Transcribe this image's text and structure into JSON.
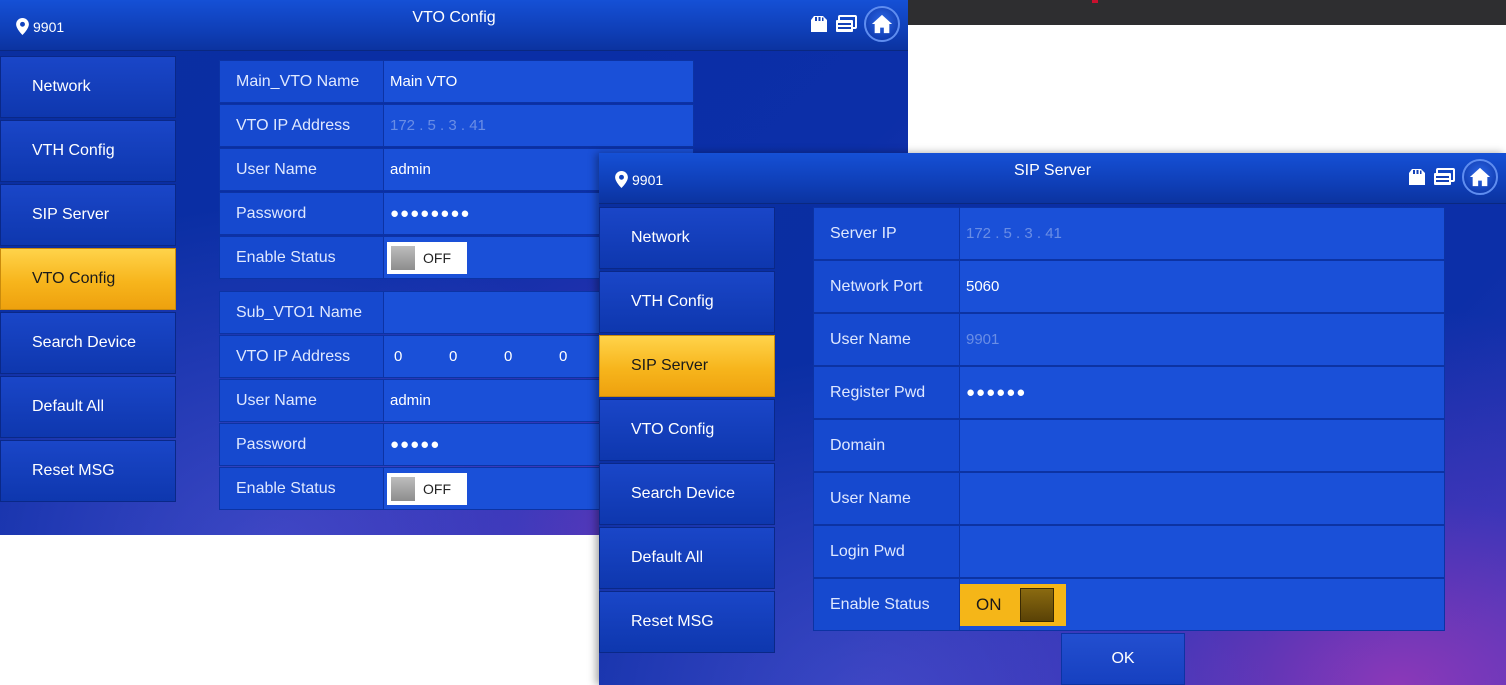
{
  "topstrip": {
    "mark_color": "#c8102e"
  },
  "panel_vto": {
    "location": "9901",
    "title": "VTO Config",
    "nav": [
      "Network",
      "VTH Config",
      "SIP Server",
      "VTO Config",
      "Search Device",
      "Default All",
      "Reset MSG"
    ],
    "active_nav": "VTO Config",
    "main_vto": {
      "name_label": "Main_VTO Name",
      "name_value": "Main VTO",
      "ip_label": "VTO IP Address",
      "ip_value": "172 . 5 . 3 . 41",
      "user_label": "User Name",
      "user_value": "admin",
      "pwd_label": "Password",
      "pwd_value": "●●●●●●●●",
      "status_label": "Enable Status",
      "status_value": "OFF"
    },
    "sub_vto1": {
      "name_label": "Sub_VTO1 Name",
      "name_value": "",
      "ip_label": "VTO IP Address",
      "ip_octets": [
        "0",
        "0",
        "0",
        "0"
      ],
      "user_label": "User Name",
      "user_value": "admin",
      "pwd_label": "Password",
      "pwd_value": "●●●●●",
      "status_label": "Enable Status",
      "status_value": "OFF"
    }
  },
  "panel_sip": {
    "location": "9901",
    "title": "SIP Server",
    "nav": [
      "Network",
      "VTH Config",
      "SIP Server",
      "VTO Config",
      "Search Device",
      "Default All",
      "Reset MSG"
    ],
    "active_nav": "SIP Server",
    "fields": {
      "server_ip_label": "Server IP",
      "server_ip_value": "172 . 5 . 3 . 41",
      "port_label": "Network Port",
      "port_value": "5060",
      "user_label": "User Name",
      "user_value": "9901",
      "reg_pwd_label": "Register Pwd",
      "reg_pwd_value": "●●●●●●",
      "domain_label": "Domain",
      "domain_value": "",
      "user2_label": "User Name",
      "user2_value": "",
      "login_pwd_label": "Login Pwd",
      "login_pwd_value": "",
      "status_label": "Enable Status",
      "status_value": "ON"
    },
    "ok_label": "OK"
  },
  "icons": [
    "location-pin-icon",
    "sd-card-icon",
    "intercom-icon",
    "home-icon"
  ],
  "colors": {
    "active_nav": "#f7b51c",
    "panel_blue": "#0a2ea6",
    "toggle_on": "#f5b618"
  }
}
